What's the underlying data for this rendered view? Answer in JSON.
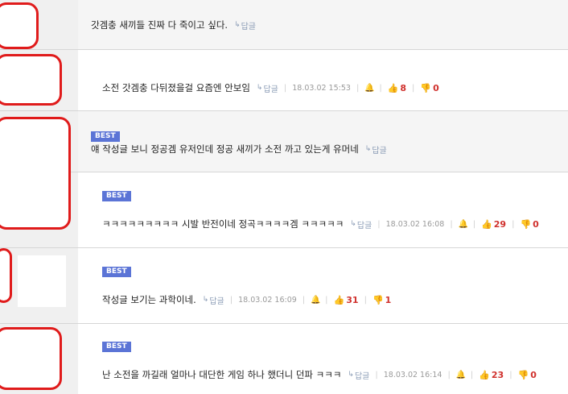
{
  "comments": [
    {
      "text": "갓겜충 새끼들 진짜 다 죽이고 싶다.",
      "reply_label": "답글",
      "best": false
    },
    {
      "text": "소전 갓겜충 다뒤졌을걸 요즘엔 안보임",
      "reply_label": "답글",
      "date": "18.03.02 15:53",
      "likes": "8",
      "dislikes": "0",
      "best": false
    },
    {
      "badge": "BEST",
      "text": "얘 작성글 보니 정공겜 유저인데 정공 새끼가 소전 까고 있는게 유머네",
      "reply_label": "답글"
    },
    {
      "badge": "BEST",
      "text": "ㅋㅋㅋㅋㅋㅋㅋㅋㅋ 시발 반전이네 정곡ㅋㅋㅋㅋ겜 ㅋㅋㅋㅋㅋ",
      "reply_label": "답글",
      "date": "18.03.02 16:08",
      "likes": "29",
      "dislikes": "0"
    },
    {
      "badge": "BEST",
      "text": "작성글 보기는 과학이네.",
      "reply_label": "답글",
      "date": "18.03.02 16:09",
      "likes": "31",
      "dislikes": "1"
    },
    {
      "badge": "BEST",
      "text": "난 소전을 까길래 얼마나 대단한 게임 하나 했더니 던파 ㅋㅋㅋ",
      "reply_label": "답글",
      "date": "18.03.02 16:14",
      "likes": "23",
      "dislikes": "0"
    }
  ],
  "icons": {
    "reply": "reply-arrow-icon",
    "report": "bell-icon",
    "like": "thumbs-up-icon",
    "dislike": "thumbs-down-icon"
  },
  "colors": {
    "badge": "#5b74d6",
    "redaction": "#e01b1b",
    "vote_count": "#d0312d"
  }
}
